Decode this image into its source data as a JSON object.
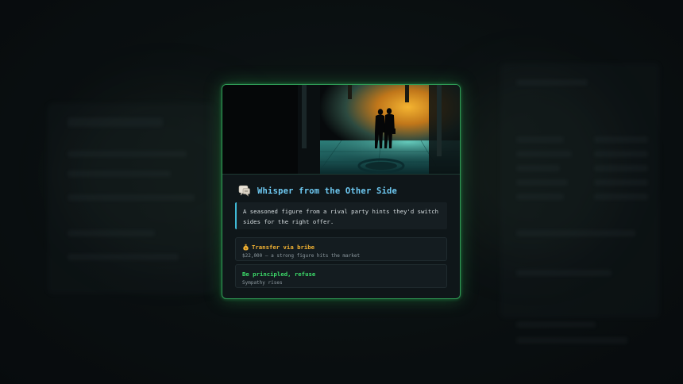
{
  "modal": {
    "title": "Whisper from the Other Side",
    "title_icon": "speech-bubble-icon",
    "description": "A seasoned figure from a rival party hints they'd switch sides for the right offer.",
    "scene_image": "two-figures-in-corridor-illustration"
  },
  "choices": [
    {
      "icon": "money-bag-icon",
      "label": "Transfer via bribe",
      "detail": "$22,000 — a strong figure hits the market",
      "color": "#f2b233"
    },
    {
      "label": "Be principled, refuse",
      "detail": "Sympathy rises",
      "color": "#3ddc6a"
    }
  ],
  "colors": {
    "accent_border": "#2f9a55",
    "title": "#6ec9f2",
    "description_bar": "#3fb8d4",
    "modal_bg": "#0f1619"
  }
}
